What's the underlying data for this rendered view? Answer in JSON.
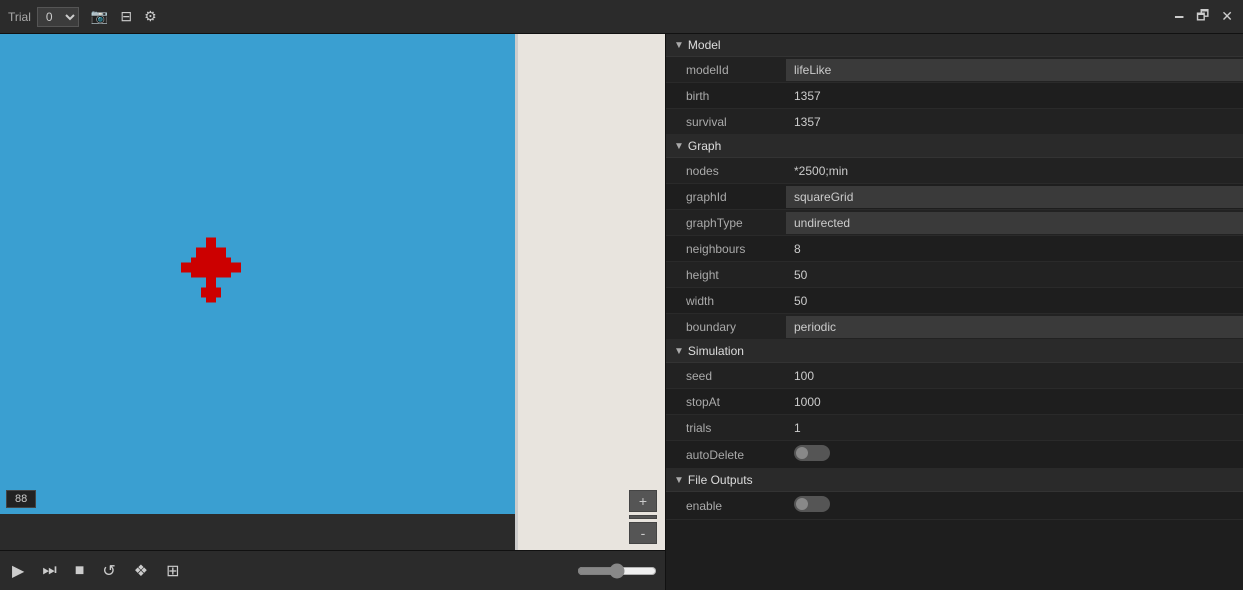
{
  "topBar": {
    "trialLabel": "Trial",
    "trialValue": "0",
    "icons": [
      "camera-icon",
      "table-icon",
      "gear-icon"
    ],
    "windowControls": [
      "minimize-icon",
      "maximize-icon",
      "close-icon"
    ]
  },
  "canvas": {
    "frameCounter": "88",
    "zoomButtons": {
      "plus": "+",
      "minus": "-"
    }
  },
  "bottomBar": {
    "play": "▶",
    "stepForward": "⏭",
    "stop": "■",
    "reset": "↺",
    "grid": "❖",
    "table": "⊞",
    "sliderValue": "50"
  },
  "properties": {
    "sections": [
      {
        "title": "Model",
        "fields": [
          {
            "label": "modelId",
            "value": "lifeLike"
          },
          {
            "label": "birth",
            "value": "1357"
          },
          {
            "label": "survival",
            "value": "1357"
          }
        ]
      },
      {
        "title": "Graph",
        "fields": [
          {
            "label": "nodes",
            "value": "*2500;min"
          },
          {
            "label": "graphId",
            "value": "squareGrid"
          },
          {
            "label": "graphType",
            "value": "undirected"
          },
          {
            "label": "neighbours",
            "value": "8"
          },
          {
            "label": "height",
            "value": "50"
          },
          {
            "label": "width",
            "value": "50"
          },
          {
            "label": "boundary",
            "value": "periodic"
          }
        ]
      },
      {
        "title": "Simulation",
        "fields": [
          {
            "label": "seed",
            "value": "100"
          },
          {
            "label": "stopAt",
            "value": "1000"
          },
          {
            "label": "trials",
            "value": "1"
          },
          {
            "label": "autoDelete",
            "value": "toggle",
            "type": "toggle"
          }
        ]
      },
      {
        "title": "File Outputs",
        "fields": [
          {
            "label": "enable",
            "value": "toggle",
            "type": "toggle"
          }
        ]
      }
    ]
  }
}
